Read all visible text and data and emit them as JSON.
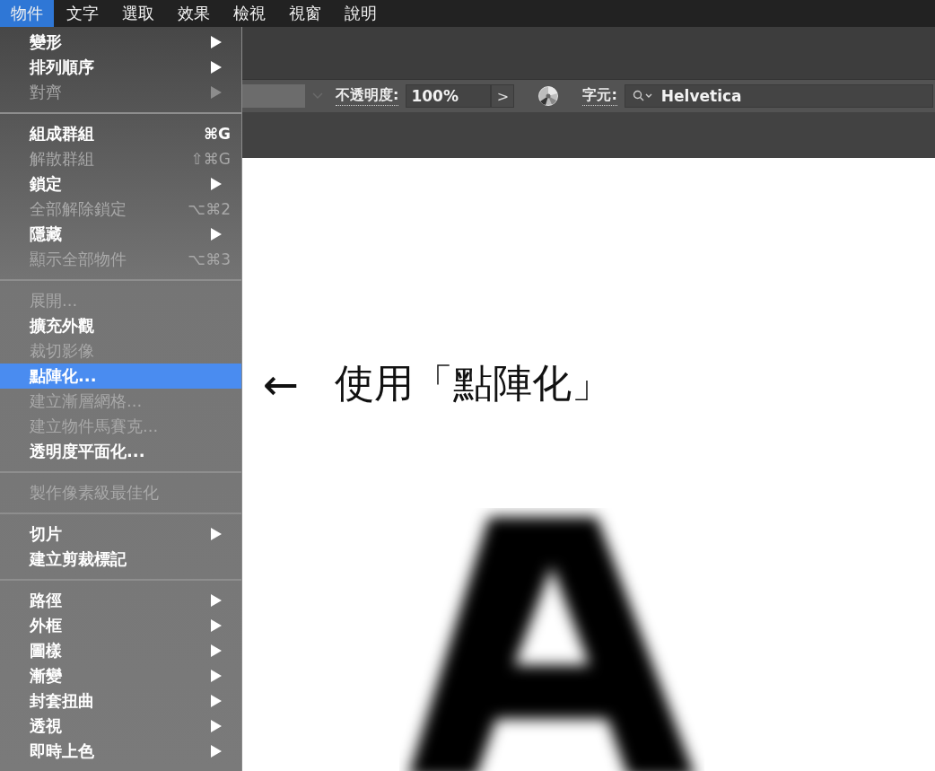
{
  "menubar": [
    {
      "label": "物件",
      "selected": true
    },
    {
      "label": "文字",
      "selected": false
    },
    {
      "label": "選取",
      "selected": false
    },
    {
      "label": "效果",
      "selected": false
    },
    {
      "label": "檢視",
      "selected": false
    },
    {
      "label": "視窗",
      "selected": false
    },
    {
      "label": "說明",
      "selected": false
    }
  ],
  "menu": [
    {
      "kind": "item",
      "label": "變形",
      "disabled": false,
      "submenu": true,
      "selected": false
    },
    {
      "kind": "item",
      "label": "排列順序",
      "disabled": false,
      "submenu": true,
      "selected": false
    },
    {
      "kind": "item",
      "label": "對齊",
      "disabled": true,
      "submenu": true,
      "selected": false
    },
    {
      "kind": "separator"
    },
    {
      "kind": "item",
      "label": "組成群組",
      "disabled": false,
      "submenu": false,
      "shortcut": "⌘G",
      "selected": false
    },
    {
      "kind": "item",
      "label": "解散群組",
      "disabled": true,
      "submenu": false,
      "shortcut": "⇧⌘G",
      "selected": false
    },
    {
      "kind": "item",
      "label": "鎖定",
      "disabled": false,
      "submenu": true,
      "selected": false
    },
    {
      "kind": "item",
      "label": "全部解除鎖定",
      "disabled": true,
      "submenu": false,
      "shortcut": "⌥⌘2",
      "selected": false
    },
    {
      "kind": "item",
      "label": "隱藏",
      "disabled": false,
      "submenu": true,
      "selected": false
    },
    {
      "kind": "item",
      "label": "顯示全部物件",
      "disabled": true,
      "submenu": false,
      "shortcut": "⌥⌘3",
      "selected": false
    },
    {
      "kind": "separator"
    },
    {
      "kind": "item",
      "label": "展開...",
      "disabled": true,
      "submenu": false,
      "selected": false
    },
    {
      "kind": "item",
      "label": "擴充外觀",
      "disabled": false,
      "submenu": false,
      "selected": false
    },
    {
      "kind": "item",
      "label": "裁切影像",
      "disabled": true,
      "submenu": false,
      "selected": false
    },
    {
      "kind": "item",
      "label": "點陣化...",
      "disabled": false,
      "submenu": false,
      "selected": true
    },
    {
      "kind": "item",
      "label": "建立漸層網格...",
      "disabled": true,
      "submenu": false,
      "selected": false
    },
    {
      "kind": "item",
      "label": "建立物件馬賽克...",
      "disabled": true,
      "submenu": false,
      "selected": false
    },
    {
      "kind": "item",
      "label": "透明度平面化...",
      "disabled": false,
      "submenu": false,
      "selected": false
    },
    {
      "kind": "separator"
    },
    {
      "kind": "item",
      "label": "製作像素級最佳化",
      "disabled": true,
      "submenu": false,
      "selected": false
    },
    {
      "kind": "separator"
    },
    {
      "kind": "item",
      "label": "切片",
      "disabled": false,
      "submenu": true,
      "selected": false
    },
    {
      "kind": "item",
      "label": "建立剪裁標記",
      "disabled": false,
      "submenu": false,
      "selected": false
    },
    {
      "kind": "separator"
    },
    {
      "kind": "item",
      "label": "路徑",
      "disabled": false,
      "submenu": true,
      "selected": false
    },
    {
      "kind": "item",
      "label": "外框",
      "disabled": false,
      "submenu": true,
      "selected": false
    },
    {
      "kind": "item",
      "label": "圖樣",
      "disabled": false,
      "submenu": true,
      "selected": false
    },
    {
      "kind": "item",
      "label": "漸變",
      "disabled": false,
      "submenu": true,
      "selected": false
    },
    {
      "kind": "item",
      "label": "封套扭曲",
      "disabled": false,
      "submenu": true,
      "selected": false
    },
    {
      "kind": "item",
      "label": "透視",
      "disabled": false,
      "submenu": true,
      "selected": false
    },
    {
      "kind": "item",
      "label": "即時上色",
      "disabled": false,
      "submenu": true,
      "selected": false
    }
  ],
  "control_bar": {
    "opacity_label": "不透明度:",
    "opacity_value": "100%",
    "opacity_button": ">",
    "character_label": "字元:",
    "font_value": "Helvetica"
  },
  "annotation": {
    "arrow": "←",
    "text": "使用「點陣化」"
  }
}
